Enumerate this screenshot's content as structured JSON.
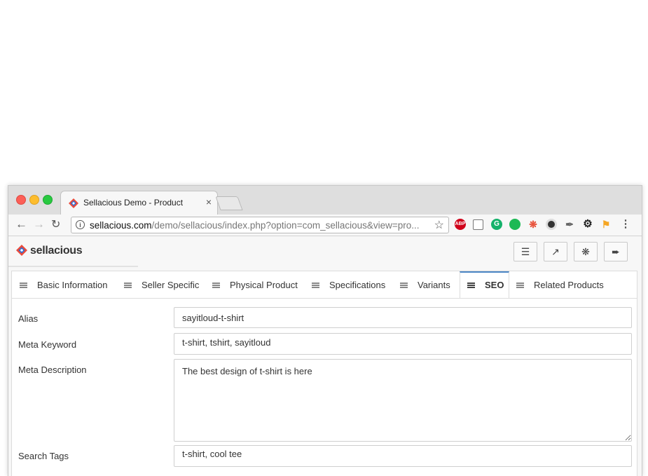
{
  "browser": {
    "tab_title": "Sellacious Demo - Product",
    "tab_close": "×",
    "url_host": "sellacious.com",
    "url_path": "/demo/sellacious/index.php?option=com_sellacious&view=pro...",
    "extensions": [
      {
        "name": "abp-icon",
        "label": "ABP",
        "color": "#d0021b"
      },
      {
        "name": "camera-icon",
        "label": "",
        "color": "#9b9b9b"
      },
      {
        "name": "grammarly-icon",
        "label": "G",
        "color": "#15b26b"
      },
      {
        "name": "chat-icon",
        "label": "",
        "color": "#1db954"
      },
      {
        "name": "joomla-icon",
        "label": "",
        "color": "#e8553e"
      },
      {
        "name": "chrome-ext-icon",
        "label": "",
        "color": "#333333"
      },
      {
        "name": "eyedropper-icon",
        "label": "",
        "color": "#666666"
      },
      {
        "name": "gear-icon",
        "label": "",
        "color": "#222222"
      },
      {
        "name": "flag-icon",
        "label": "",
        "color": "#f5a623"
      }
    ]
  },
  "app": {
    "brand": "sellacious"
  },
  "tabs": [
    {
      "label": "Basic Information"
    },
    {
      "label": "Seller Specific"
    },
    {
      "label": "Physical Product"
    },
    {
      "label": "Specifications"
    },
    {
      "label": "Variants"
    },
    {
      "label": "SEO"
    },
    {
      "label": "Related Products"
    }
  ],
  "form": {
    "alias_label": "Alias",
    "alias_value": "sayitloud-t-shirt",
    "meta_keyword_label": "Meta Keyword",
    "meta_keyword_value": "t-shirt, tshirt, sayitloud",
    "meta_description_label": "Meta Description",
    "meta_description_value": "The best design of t-shirt is here",
    "search_tags_label": "Search Tags",
    "search_tags_value": "t-shirt, cool tee"
  }
}
